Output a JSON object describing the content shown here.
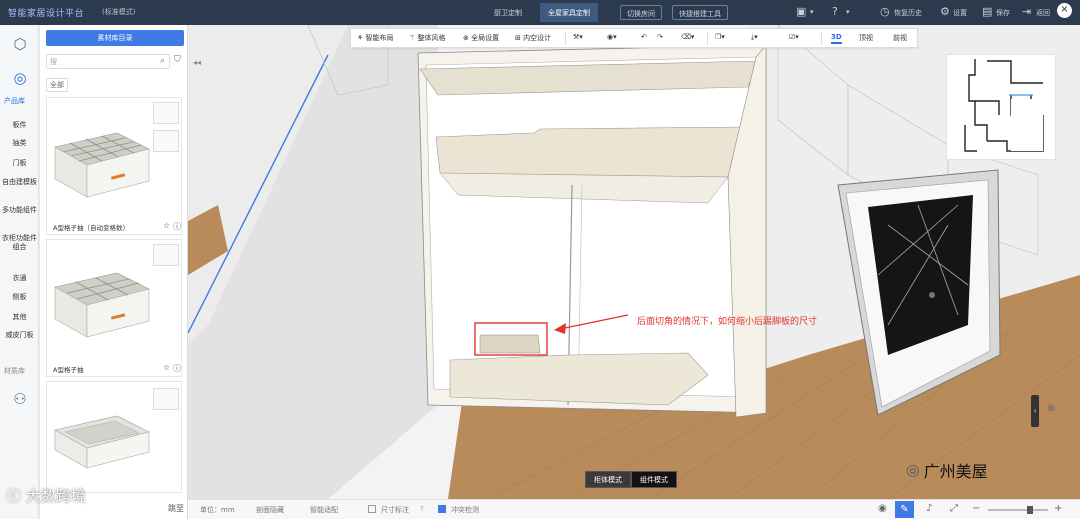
{
  "topbar": {
    "brand": "智能家居设计平台",
    "mode": "(标准模式)",
    "tabs": [
      {
        "label": "厨卫定制",
        "active": false
      },
      {
        "label": "全屋家具定制",
        "active": true
      }
    ],
    "tool_buttons": [
      "切换房间",
      "快捷搭建工具"
    ],
    "right_items": [
      "恢复历史",
      "设置",
      "保存",
      "返回"
    ]
  },
  "left_strip": {
    "header_product": "产品库",
    "items": [
      "板件",
      "抽类",
      "门板",
      "自由建模板",
      "多功能组件",
      "衣柜功能件组合",
      "衣通",
      "侧板",
      "其他",
      "威皮门板"
    ],
    "header_material": "材质库"
  },
  "catalog": {
    "button_label": "素材库目录",
    "search_placeholder": "搜",
    "filter_chip": "全部",
    "cards": [
      {
        "label": "A型格子抽（自动变格数）"
      },
      {
        "label": "A型格子抽"
      },
      {
        "label": ""
      }
    ],
    "pager_label": "跳至"
  },
  "toolbar": {
    "items": [
      "智能布局",
      "整体风格",
      "全局设置",
      "内空设计"
    ],
    "views": [
      {
        "label": "3D",
        "active": true
      },
      {
        "label": "顶视",
        "active": false
      },
      {
        "label": "前视",
        "active": false
      }
    ]
  },
  "viewport": {
    "annotation": "后面切角的情况下，如何缩小后踢脚板的尺寸",
    "mode_toggle": [
      {
        "label": "柜体模式",
        "active": false
      },
      {
        "label": "组件模式",
        "active": true
      }
    ]
  },
  "statusbar": {
    "unit": "单位：mm",
    "items": [
      "剖面隐藏",
      "智能适配"
    ],
    "checkboxes": [
      {
        "label": "尺寸标注",
        "checked": false
      },
      {
        "label": "冲突检测",
        "checked": true
      }
    ],
    "zoom_level": 0.7
  },
  "watermarks": {
    "left": "大数跨境",
    "right": "广州美屋"
  },
  "colors": {
    "topbar": "#2b3a4d",
    "accent": "#3f7ae6",
    "annotation": "#e0352b",
    "floor": "#b98a5a"
  }
}
